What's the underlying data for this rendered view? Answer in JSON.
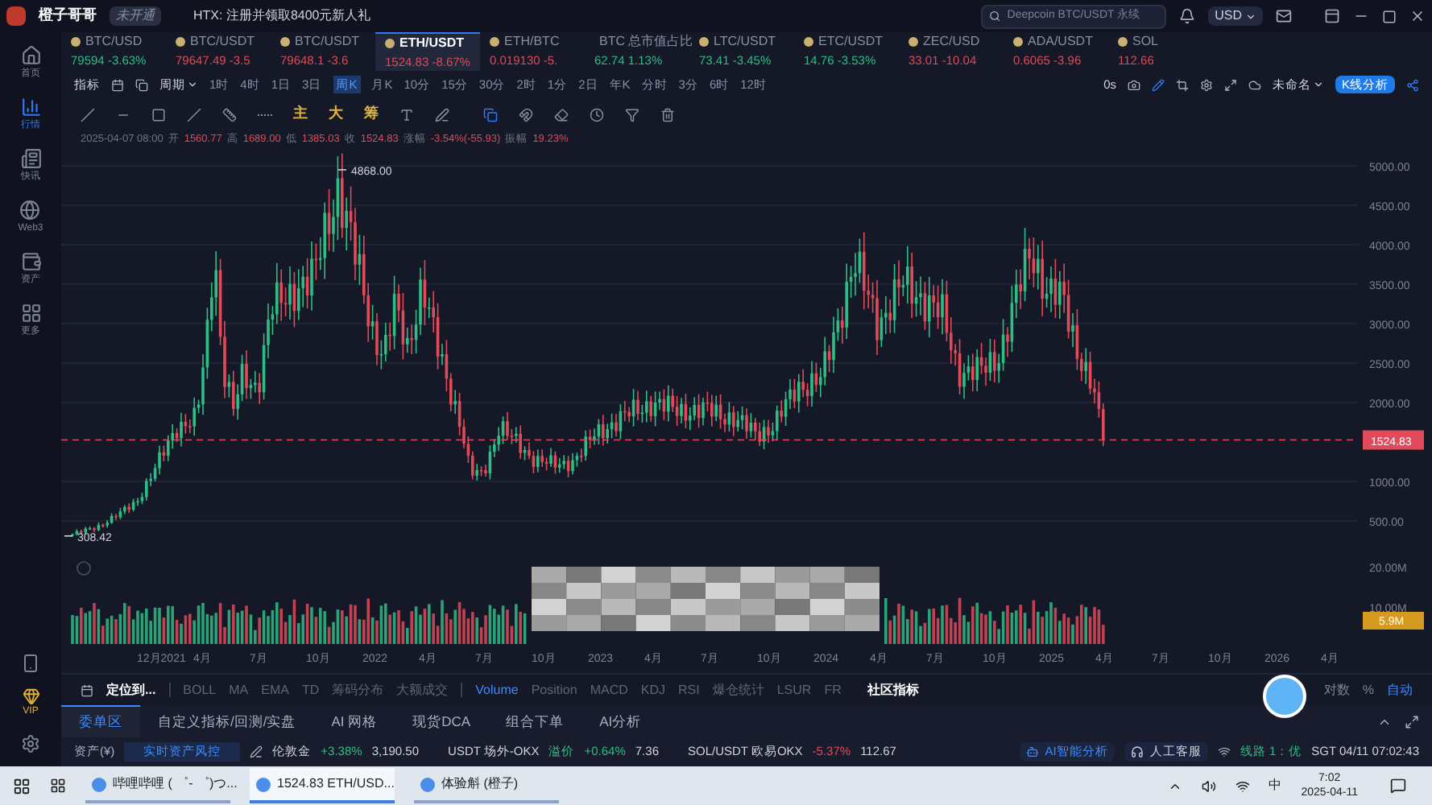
{
  "title_bar": {
    "app_name": "橙子哥哥",
    "account_badge": "未开通",
    "promo": "HTX: 注册并领取8400元新人礼",
    "search": {
      "placeholder": "Deepcoin BTC/USDT 永续"
    },
    "currency": "USD"
  },
  "sidebar": {
    "items": [
      {
        "label": "首页",
        "kind": "home",
        "selected": false
      },
      {
        "label": "行情",
        "kind": "chart",
        "selected": true
      },
      {
        "label": "快讯",
        "kind": "news",
        "selected": false
      },
      {
        "label": "Web3",
        "kind": "web3",
        "selected": false
      },
      {
        "label": "资产",
        "kind": "wallet",
        "selected": false
      },
      {
        "label": "更多",
        "kind": "more",
        "selected": false
      }
    ],
    "vip_label": "VIP"
  },
  "tickers": [
    {
      "symbol": "BTC/USD",
      "price": "79594",
      "change": "-3.63%",
      "color": "#2ebd85",
      "selected": false
    },
    {
      "symbol": "BTC/USDT",
      "price": "79647.49",
      "change": "-3.5",
      "color": "#e04a59",
      "selected": false
    },
    {
      "symbol": "BTC/USDT",
      "price": "79648.1",
      "change": "-3.6",
      "color": "#e04a59",
      "selected": false
    },
    {
      "symbol": "ETH/USDT",
      "price": "1524.83",
      "change": "-8.67%",
      "color": "#e04a59",
      "selected": true
    },
    {
      "symbol": "ETH/BTC",
      "price": "0.019130",
      "change": "-5.",
      "color": "#e04a59",
      "selected": false
    },
    {
      "symbol": "BTC 总市值占比",
      "price": "62.74",
      "change": "1.13%",
      "color": "#2ebd85",
      "selected": false
    },
    {
      "symbol": "LTC/USDT",
      "price": "73.41",
      "change": "-3.45%",
      "color": "#2ebd85",
      "selected": false
    },
    {
      "symbol": "ETC/USDT",
      "price": "14.76",
      "change": "-3.53%",
      "color": "#2ebd85",
      "selected": false
    },
    {
      "symbol": "ZEC/USD",
      "price": "33.01",
      "change": "-10.04",
      "color": "#e04a59",
      "selected": false
    },
    {
      "symbol": "ADA/USDT",
      "price": "0.6065",
      "change": "-3.96",
      "color": "#e04a59",
      "selected": false
    },
    {
      "symbol": "SOL",
      "price": "112.66",
      "color": "#e04a59",
      "selected": false
    }
  ],
  "interval_bar": {
    "indicator_button": "指标",
    "period_button": "周期",
    "intervals": [
      {
        "label": "1时",
        "selected": false
      },
      {
        "label": "4时",
        "selected": false
      },
      {
        "label": "1日",
        "selected": false
      },
      {
        "label": "3日",
        "selected": false
      },
      {
        "label": "周K",
        "selected": true
      },
      {
        "label": "月K",
        "selected": false
      },
      {
        "label": "10分",
        "selected": false
      },
      {
        "label": "15分",
        "selected": false
      },
      {
        "label": "30分",
        "selected": false
      },
      {
        "label": "2时",
        "selected": false
      },
      {
        "label": "1分",
        "selected": false
      },
      {
        "label": "2日",
        "selected": false
      },
      {
        "label": "年K",
        "selected": false
      },
      {
        "label": "分时",
        "selected": false
      },
      {
        "label": "3分",
        "selected": false
      },
      {
        "label": "6时",
        "selected": false
      },
      {
        "label": "12时",
        "selected": false
      }
    ],
    "countdown": "0s",
    "layout_name": "未命名",
    "analysis_button": "K线分析"
  },
  "drawing_tools": {
    "overlay_toggles": [
      "主",
      "大",
      "筹"
    ]
  },
  "ohlc": {
    "date": "2025-04-07 08:00",
    "fields": [
      {
        "label": "开",
        "value": "1560.77"
      },
      {
        "label": "高",
        "value": "1689.00"
      },
      {
        "label": "低",
        "value": "1385.03"
      },
      {
        "label": "收",
        "value": "1524.83"
      },
      {
        "label": "涨幅",
        "value": "-3.54%(-55.93)"
      },
      {
        "label": "振幅",
        "value": "19.23%"
      }
    ]
  },
  "chart": {
    "high_label": "4868.00",
    "low_label": "308.42",
    "last_price": "1524.83",
    "price_axis": [
      "5000.00",
      "4500.00",
      "4000.00",
      "3500.00",
      "3000.00",
      "2500.00",
      "2000.00",
      "1000.00",
      "500.00"
    ],
    "volume_axis": [
      "20.00M",
      "10.00M"
    ],
    "volume_last": "5.9M",
    "time_axis": [
      "12月2021",
      "4月",
      "7月",
      "10月",
      "2022",
      "4月",
      "7月",
      "10月",
      "2023",
      "4月",
      "7月",
      "10月",
      "2024",
      "4月",
      "7月",
      "10月",
      "2025",
      "4月",
      "7月",
      "10月",
      "2026",
      "4月"
    ]
  },
  "indicators": {
    "locate": "定位到...",
    "main": [
      "BOLL",
      "MA",
      "EMA",
      "TD",
      "筹码分布",
      "大额成交"
    ],
    "sub": [
      {
        "label": "Volume",
        "selected": true
      },
      {
        "label": "Position",
        "selected": false
      },
      {
        "label": "MACD",
        "selected": false
      },
      {
        "label": "KDJ",
        "selected": false
      },
      {
        "label": "RSI",
        "selected": false
      },
      {
        "label": "爆仓统计",
        "selected": false
      },
      {
        "label": "LSUR",
        "selected": false
      },
      {
        "label": "FR",
        "selected": false
      }
    ],
    "community": "社区指标",
    "scale": [
      {
        "label": "对数",
        "selected": false
      },
      {
        "label": "%",
        "selected": false
      },
      {
        "label": "自动",
        "selected": true
      }
    ]
  },
  "bottom_tabs": [
    {
      "label": "委单区",
      "selected": true
    },
    {
      "label": "自定义指标/回测/实盘",
      "selected": false
    },
    {
      "label": "AI 网格",
      "selected": false
    },
    {
      "label": "现货DCA",
      "selected": false
    },
    {
      "label": "组合下单",
      "selected": false
    },
    {
      "label": "AI分析",
      "selected": false
    }
  ],
  "status_bar": {
    "assets_label": "资产(¥)",
    "risk_button": "实时资产风控",
    "quotes": [
      {
        "name": "伦敦金",
        "change": "+3.38%",
        "color": "#2ebd85",
        "value": "3,190.50"
      },
      {
        "name": "USDT 场外-OKX",
        "extra": "溢价",
        "change": "+0.64%",
        "color": "#2ebd85",
        "value": "7.36"
      },
      {
        "name": "SOL/USDT 欧易OKX",
        "change": "-5.37%",
        "color": "#e04a59",
        "value": "112.67"
      }
    ],
    "ai_button": "AI智能分析",
    "service_button": "人工客服",
    "line_status": "线路 1：优",
    "clock": "SGT 04/11 07:02:43"
  },
  "taskbar": {
    "apps": [
      {
        "label": "哔哩哔哩 ( ゜- ゜)つ...",
        "selected": false
      },
      {
        "label": "1524.83 ETH/USD...",
        "selected": true
      },
      {
        "label": "体验斛 (橙子)",
        "selected": false
      }
    ],
    "ime": "中",
    "time": "7:02",
    "date": "2025-04-11"
  }
}
